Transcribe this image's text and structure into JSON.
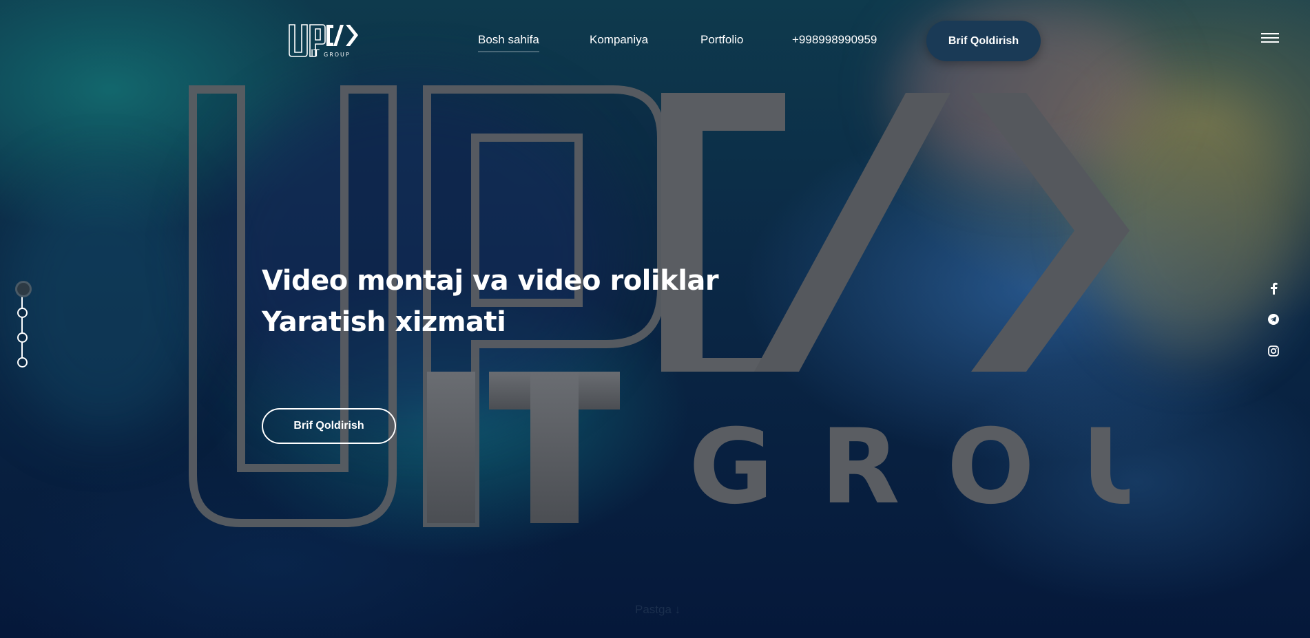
{
  "header": {
    "nav": [
      {
        "label": "Bosh sahifa",
        "active": true
      },
      {
        "label": "Kompaniya",
        "active": false
      },
      {
        "label": "Portfolio",
        "active": false
      },
      {
        "label": "+998998990959",
        "active": false
      }
    ],
    "cta_label": "Brif Qoldirish"
  },
  "logo": {
    "mark": "UP",
    "code": "</>",
    "it": "IT",
    "group": "GROUP"
  },
  "background_logo": {
    "mark": "UP",
    "it": "IT",
    "group": "GROUP"
  },
  "hero": {
    "title_line1": "Video montaj va video roliklar",
    "title_line2": "Yaratish xizmati",
    "cta_label": "Brif Qoldirish"
  },
  "pager": {
    "count": 4,
    "active_index": 0
  },
  "social": [
    "facebook-icon",
    "telegram-icon",
    "instagram-icon"
  ],
  "scroll_hint": "Pastga ↓",
  "colors": {
    "cta_bg": "#1a3a56",
    "text": "#ffffff",
    "bg_dark": "#05183a"
  }
}
